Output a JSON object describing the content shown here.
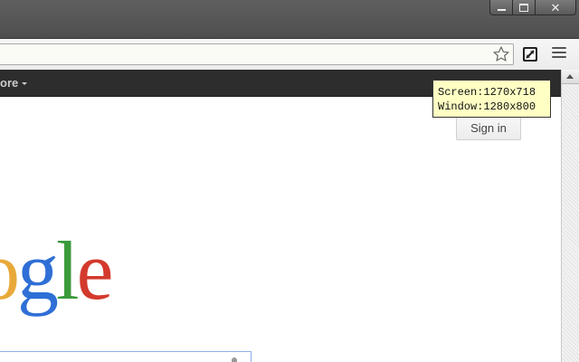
{
  "window": {
    "controls": {
      "minimize_icon": "minimize-icon",
      "maximize_icon": "maximize-icon",
      "close_icon": "close-icon",
      "close_glyph": "✕"
    }
  },
  "toolbar": {
    "omnibox_value": "",
    "bookmark_icon": "star-icon",
    "extension_icon": "window-resizer-icon",
    "menu_icon": "hamburger-menu-icon"
  },
  "google_bar": {
    "more_label": "ore"
  },
  "page": {
    "sign_in_label": "Sign in",
    "logo_letters": [
      "o",
      "g",
      "l",
      "e"
    ],
    "search_value": ""
  },
  "tooltip": {
    "screen_line": "Screen:1270x718",
    "window_line": "Window:1280x800"
  },
  "colors": {
    "titlebar": "#555555",
    "gbar": "#2d2d2d",
    "tooltip_bg": "#ffffc4",
    "logo_o1": "#e8a93a",
    "logo_g": "#2f6fd6",
    "logo_l": "#3c9a3c",
    "logo_e": "#d33a2c"
  }
}
